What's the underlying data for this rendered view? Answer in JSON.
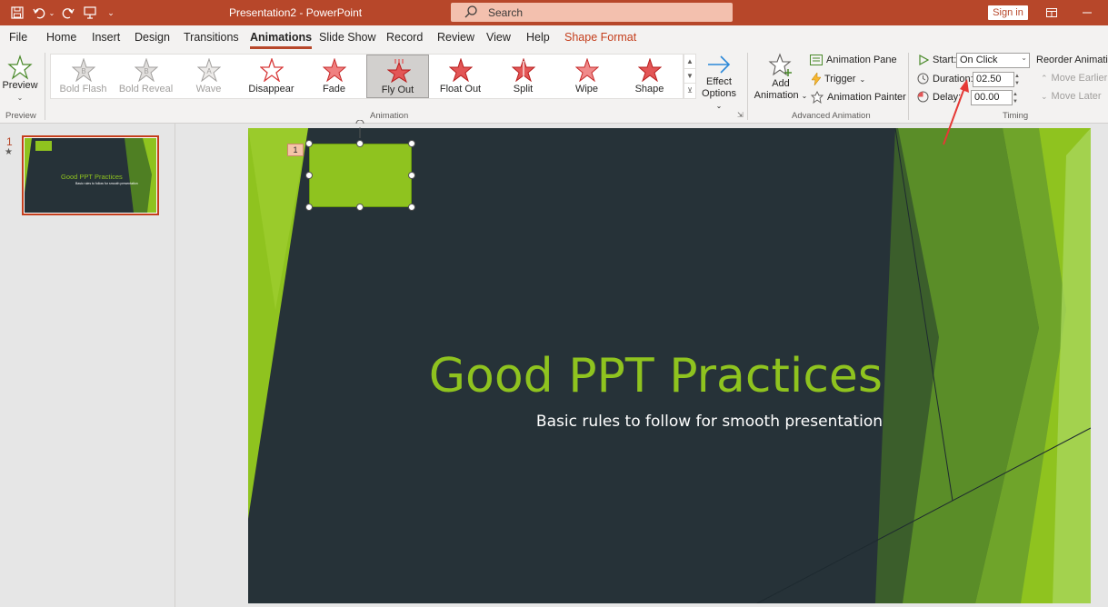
{
  "titlebar": {
    "title": "Presentation2  -  PowerPoint",
    "search_placeholder": "Search",
    "signin_label": "Sign in",
    "quick_access": [
      "save-icon",
      "undo-icon",
      "redo-icon",
      "present-icon",
      "customize-icon"
    ]
  },
  "menu": {
    "tabs": [
      "File",
      "Home",
      "Insert",
      "Design",
      "Transitions",
      "Animations",
      "Slide Show",
      "Record",
      "Review",
      "View",
      "Help",
      "Shape Format"
    ],
    "active": "Animations",
    "contextual": "Shape Format"
  },
  "ribbon": {
    "preview": {
      "label": "Preview",
      "group": "Preview"
    },
    "animation_group": "Animation",
    "animations": [
      {
        "label": "Bold Flash",
        "state": "disabled"
      },
      {
        "label": "Bold Reveal",
        "state": "disabled"
      },
      {
        "label": "Wave",
        "state": "disabled"
      },
      {
        "label": "Disappear",
        "state": "exit"
      },
      {
        "label": "Fade",
        "state": "exit"
      },
      {
        "label": "Fly Out",
        "state": "selected"
      },
      {
        "label": "Float Out",
        "state": "exit"
      },
      {
        "label": "Split",
        "state": "exit"
      },
      {
        "label": "Wipe",
        "state": "exit"
      },
      {
        "label": "Shape",
        "state": "exit"
      }
    ],
    "effect_options": {
      "line1": "Effect",
      "line2": "Options"
    },
    "advanced": {
      "group": "Advanced Animation",
      "add_line1": "Add",
      "add_line2": "Animation",
      "pane": "Animation Pane",
      "trigger": "Trigger",
      "painter": "Animation Painter"
    },
    "timing": {
      "group": "Timing",
      "start_label": "Start:",
      "start_value": "On Click",
      "duration_label": "Duration:",
      "duration_value": "02.50",
      "delay_label": "Delay:",
      "delay_value": "00.00",
      "reorder": "Reorder Animation",
      "move_earlier": "Move Earlier",
      "move_later": "Move Later"
    }
  },
  "slides_pane": {
    "number": "1",
    "star": "★",
    "thumb_title": "Good PPT Practices",
    "thumb_sub": "Basic rules to follow for smooth presentation"
  },
  "slide": {
    "title": "Good PPT Practices",
    "subtitle": "Basic rules to follow for smooth presentation",
    "anim_tag": "1"
  },
  "colors": {
    "accent": "#b7472a",
    "slide_bg": "#263238",
    "green": "#8fc31f",
    "arrow": "#e53935"
  }
}
